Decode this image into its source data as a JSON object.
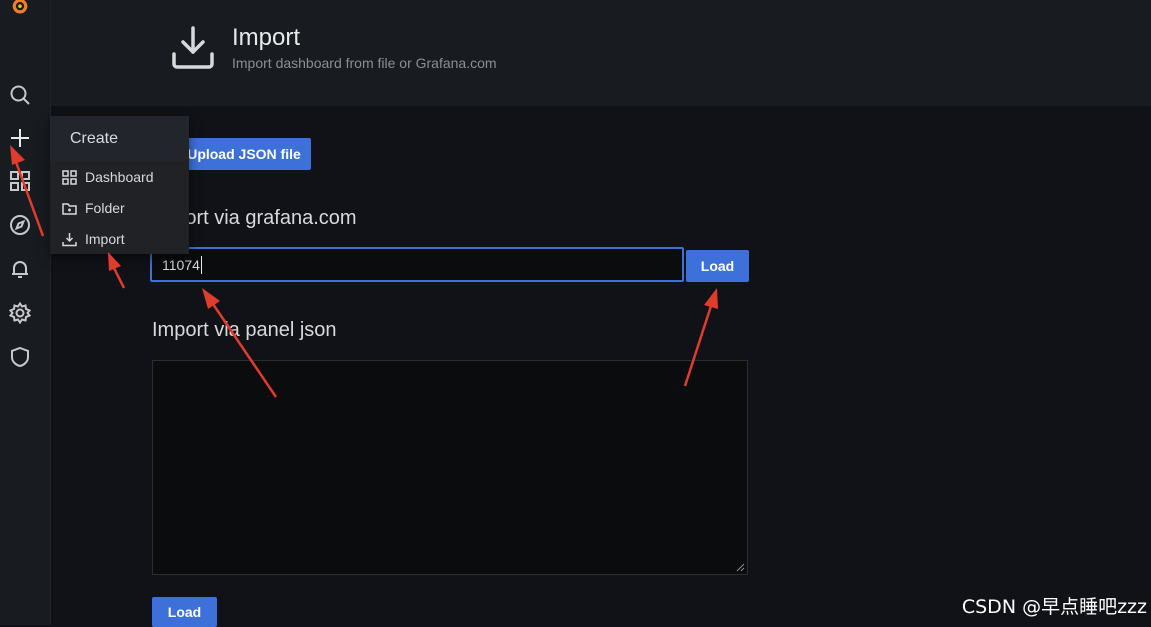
{
  "header": {
    "title": "Import",
    "subtitle": "Import dashboard from file or Grafana.com"
  },
  "sidebar": {
    "icons": [
      "grafana-logo-icon",
      "search-icon",
      "plus-icon",
      "dashboards-grid-icon",
      "explore-compass-icon",
      "alerting-bell-icon",
      "configuration-gear-icon",
      "shield-icon"
    ]
  },
  "create_menu": {
    "title": "Create",
    "items": [
      {
        "label": "Dashboard",
        "icon": "grid-icon"
      },
      {
        "label": "Folder",
        "icon": "folder-icon"
      },
      {
        "label": "Import",
        "icon": "import-icon"
      }
    ]
  },
  "upload_button": "Upload JSON file",
  "grafana_section": {
    "title": "Import via grafana.com",
    "input_value": "11074",
    "load_label": "Load"
  },
  "panel_section": {
    "title": "Import via panel json",
    "textarea_value": "",
    "load_label": "Load"
  },
  "watermark": "CSDN @早点睡吧zzz",
  "colors": {
    "accent": "#3d71d9",
    "background": "#111217",
    "sidebar": "#181b1f",
    "annotation_arrow": "#e03c2e"
  }
}
